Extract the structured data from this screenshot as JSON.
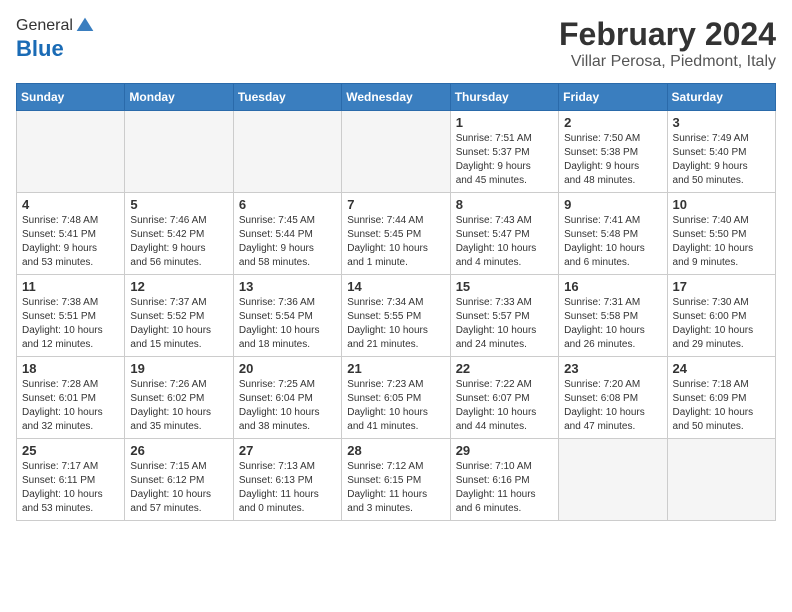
{
  "header": {
    "logo_line1": "General",
    "logo_line2": "Blue",
    "title": "February 2024",
    "subtitle": "Villar Perosa, Piedmont, Italy"
  },
  "days_of_week": [
    "Sunday",
    "Monday",
    "Tuesday",
    "Wednesday",
    "Thursday",
    "Friday",
    "Saturday"
  ],
  "weeks": [
    [
      {
        "day": "",
        "info": ""
      },
      {
        "day": "",
        "info": ""
      },
      {
        "day": "",
        "info": ""
      },
      {
        "day": "",
        "info": ""
      },
      {
        "day": "1",
        "info": "Sunrise: 7:51 AM\nSunset: 5:37 PM\nDaylight: 9 hours\nand 45 minutes."
      },
      {
        "day": "2",
        "info": "Sunrise: 7:50 AM\nSunset: 5:38 PM\nDaylight: 9 hours\nand 48 minutes."
      },
      {
        "day": "3",
        "info": "Sunrise: 7:49 AM\nSunset: 5:40 PM\nDaylight: 9 hours\nand 50 minutes."
      }
    ],
    [
      {
        "day": "4",
        "info": "Sunrise: 7:48 AM\nSunset: 5:41 PM\nDaylight: 9 hours\nand 53 minutes."
      },
      {
        "day": "5",
        "info": "Sunrise: 7:46 AM\nSunset: 5:42 PM\nDaylight: 9 hours\nand 56 minutes."
      },
      {
        "day": "6",
        "info": "Sunrise: 7:45 AM\nSunset: 5:44 PM\nDaylight: 9 hours\nand 58 minutes."
      },
      {
        "day": "7",
        "info": "Sunrise: 7:44 AM\nSunset: 5:45 PM\nDaylight: 10 hours\nand 1 minute."
      },
      {
        "day": "8",
        "info": "Sunrise: 7:43 AM\nSunset: 5:47 PM\nDaylight: 10 hours\nand 4 minutes."
      },
      {
        "day": "9",
        "info": "Sunrise: 7:41 AM\nSunset: 5:48 PM\nDaylight: 10 hours\nand 6 minutes."
      },
      {
        "day": "10",
        "info": "Sunrise: 7:40 AM\nSunset: 5:50 PM\nDaylight: 10 hours\nand 9 minutes."
      }
    ],
    [
      {
        "day": "11",
        "info": "Sunrise: 7:38 AM\nSunset: 5:51 PM\nDaylight: 10 hours\nand 12 minutes."
      },
      {
        "day": "12",
        "info": "Sunrise: 7:37 AM\nSunset: 5:52 PM\nDaylight: 10 hours\nand 15 minutes."
      },
      {
        "day": "13",
        "info": "Sunrise: 7:36 AM\nSunset: 5:54 PM\nDaylight: 10 hours\nand 18 minutes."
      },
      {
        "day": "14",
        "info": "Sunrise: 7:34 AM\nSunset: 5:55 PM\nDaylight: 10 hours\nand 21 minutes."
      },
      {
        "day": "15",
        "info": "Sunrise: 7:33 AM\nSunset: 5:57 PM\nDaylight: 10 hours\nand 24 minutes."
      },
      {
        "day": "16",
        "info": "Sunrise: 7:31 AM\nSunset: 5:58 PM\nDaylight: 10 hours\nand 26 minutes."
      },
      {
        "day": "17",
        "info": "Sunrise: 7:30 AM\nSunset: 6:00 PM\nDaylight: 10 hours\nand 29 minutes."
      }
    ],
    [
      {
        "day": "18",
        "info": "Sunrise: 7:28 AM\nSunset: 6:01 PM\nDaylight: 10 hours\nand 32 minutes."
      },
      {
        "day": "19",
        "info": "Sunrise: 7:26 AM\nSunset: 6:02 PM\nDaylight: 10 hours\nand 35 minutes."
      },
      {
        "day": "20",
        "info": "Sunrise: 7:25 AM\nSunset: 6:04 PM\nDaylight: 10 hours\nand 38 minutes."
      },
      {
        "day": "21",
        "info": "Sunrise: 7:23 AM\nSunset: 6:05 PM\nDaylight: 10 hours\nand 41 minutes."
      },
      {
        "day": "22",
        "info": "Sunrise: 7:22 AM\nSunset: 6:07 PM\nDaylight: 10 hours\nand 44 minutes."
      },
      {
        "day": "23",
        "info": "Sunrise: 7:20 AM\nSunset: 6:08 PM\nDaylight: 10 hours\nand 47 minutes."
      },
      {
        "day": "24",
        "info": "Sunrise: 7:18 AM\nSunset: 6:09 PM\nDaylight: 10 hours\nand 50 minutes."
      }
    ],
    [
      {
        "day": "25",
        "info": "Sunrise: 7:17 AM\nSunset: 6:11 PM\nDaylight: 10 hours\nand 53 minutes."
      },
      {
        "day": "26",
        "info": "Sunrise: 7:15 AM\nSunset: 6:12 PM\nDaylight: 10 hours\nand 57 minutes."
      },
      {
        "day": "27",
        "info": "Sunrise: 7:13 AM\nSunset: 6:13 PM\nDaylight: 11 hours\nand 0 minutes."
      },
      {
        "day": "28",
        "info": "Sunrise: 7:12 AM\nSunset: 6:15 PM\nDaylight: 11 hours\nand 3 minutes."
      },
      {
        "day": "29",
        "info": "Sunrise: 7:10 AM\nSunset: 6:16 PM\nDaylight: 11 hours\nand 6 minutes."
      },
      {
        "day": "",
        "info": ""
      },
      {
        "day": "",
        "info": ""
      }
    ]
  ]
}
